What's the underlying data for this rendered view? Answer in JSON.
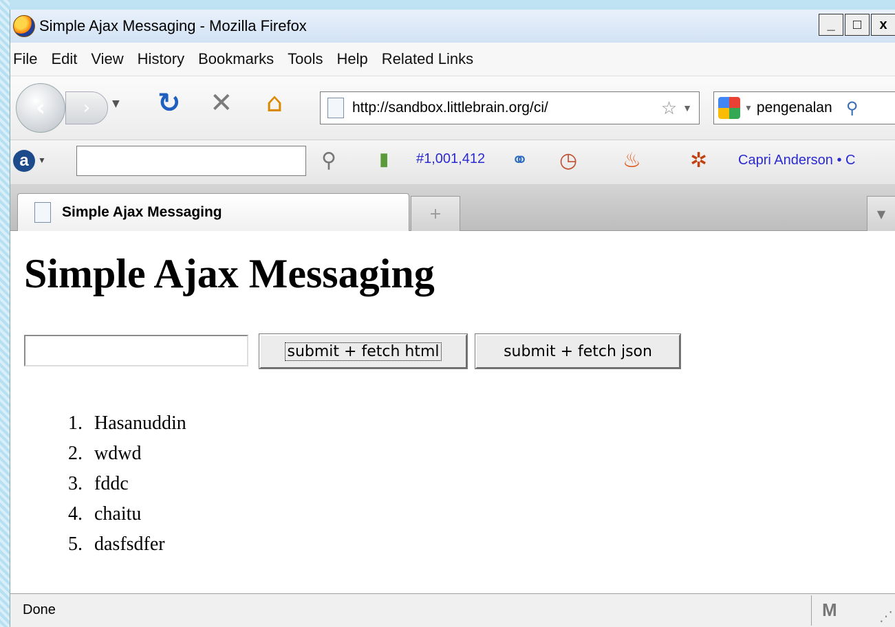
{
  "window": {
    "title": "Simple Ajax Messaging - Mozilla Firefox",
    "controls": {
      "minimize": "_",
      "maximize": "□",
      "close": "x"
    }
  },
  "menu": {
    "items": [
      {
        "label": "File"
      },
      {
        "label": "Edit"
      },
      {
        "label": "View"
      },
      {
        "label": "History"
      },
      {
        "label": "Bookmarks"
      },
      {
        "label": "Tools"
      },
      {
        "label": "Help"
      },
      {
        "label": "Related Links"
      }
    ]
  },
  "nav": {
    "url": "http://sandbox.littlebrain.org/ci/",
    "search_value": "pengenalan"
  },
  "alexa": {
    "search_value": "",
    "rank": "#1,001,412",
    "user_link": "Capri Anderson",
    "more": "• C"
  },
  "tabs": {
    "active_label": "Simple Ajax Messaging",
    "new_tab": "+"
  },
  "page": {
    "heading": "Simple Ajax Messaging",
    "input_value": "",
    "btn_html": "submit + fetch html",
    "btn_json": "submit + fetch json",
    "messages": [
      "Hasanuddin",
      "wdwd",
      "fddc",
      "chaitu",
      "dasfsdfer"
    ]
  },
  "status": {
    "text": "Done",
    "gmail_icon": "M"
  },
  "icons": {
    "back": "‹",
    "forward": "›",
    "reload": "↻",
    "stop": "✕",
    "home": "⌂",
    "star": "☆",
    "magnifier": "⚲"
  }
}
